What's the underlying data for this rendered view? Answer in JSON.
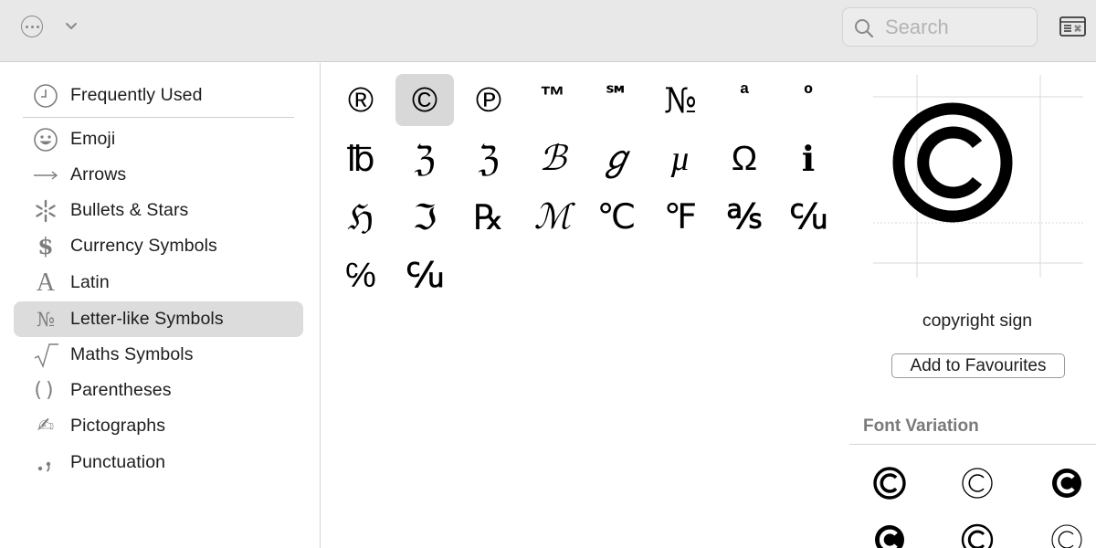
{
  "toolbar": {
    "search": {
      "placeholder": "Search"
    }
  },
  "sidebar": {
    "items": [
      {
        "label": "Frequently Used",
        "icon": "clock-icon"
      },
      {
        "label": "Emoji",
        "icon": "smiley-icon"
      },
      {
        "label": "Arrows",
        "icon": "arrow-icon"
      },
      {
        "label": "Bullets & Stars",
        "icon": "asterisk-icon"
      },
      {
        "label": "Currency Symbols",
        "icon": "dollar-icon"
      },
      {
        "label": "Latin",
        "icon": "latin-a-icon"
      },
      {
        "label": "Letter-like Symbols",
        "icon": "numero-icon",
        "selected": true
      },
      {
        "label": "Maths Symbols",
        "icon": "square-root-icon"
      },
      {
        "label": "Parentheses",
        "icon": "parentheses-icon"
      },
      {
        "label": "Pictographs",
        "icon": "pen-hand-icon"
      },
      {
        "label": "Punctuation",
        "icon": "punctuation-icon"
      }
    ]
  },
  "grid": {
    "characters": [
      "®",
      "©",
      "℗",
      "™",
      "℠",
      "№",
      "ª",
      "º",
      "℔",
      "ℨ",
      "ℨ",
      "ℬ",
      "ℊ",
      "µ",
      "Ω",
      "ℹ",
      "ℌ",
      "ℑ",
      "℞",
      "ℳ",
      "℃",
      "℉",
      "℁",
      "℆",
      "℅",
      "℆"
    ],
    "selected_index": 1
  },
  "inspector": {
    "character_name": "copyright sign",
    "add_favourite_label": "Add to Favourites",
    "font_variation_heading": "Font Variation"
  },
  "colors": {
    "toolbar_bg": "#e8e8e8",
    "selection_bg": "#dcdcdc",
    "secondary_text": "#7a7a7a"
  }
}
